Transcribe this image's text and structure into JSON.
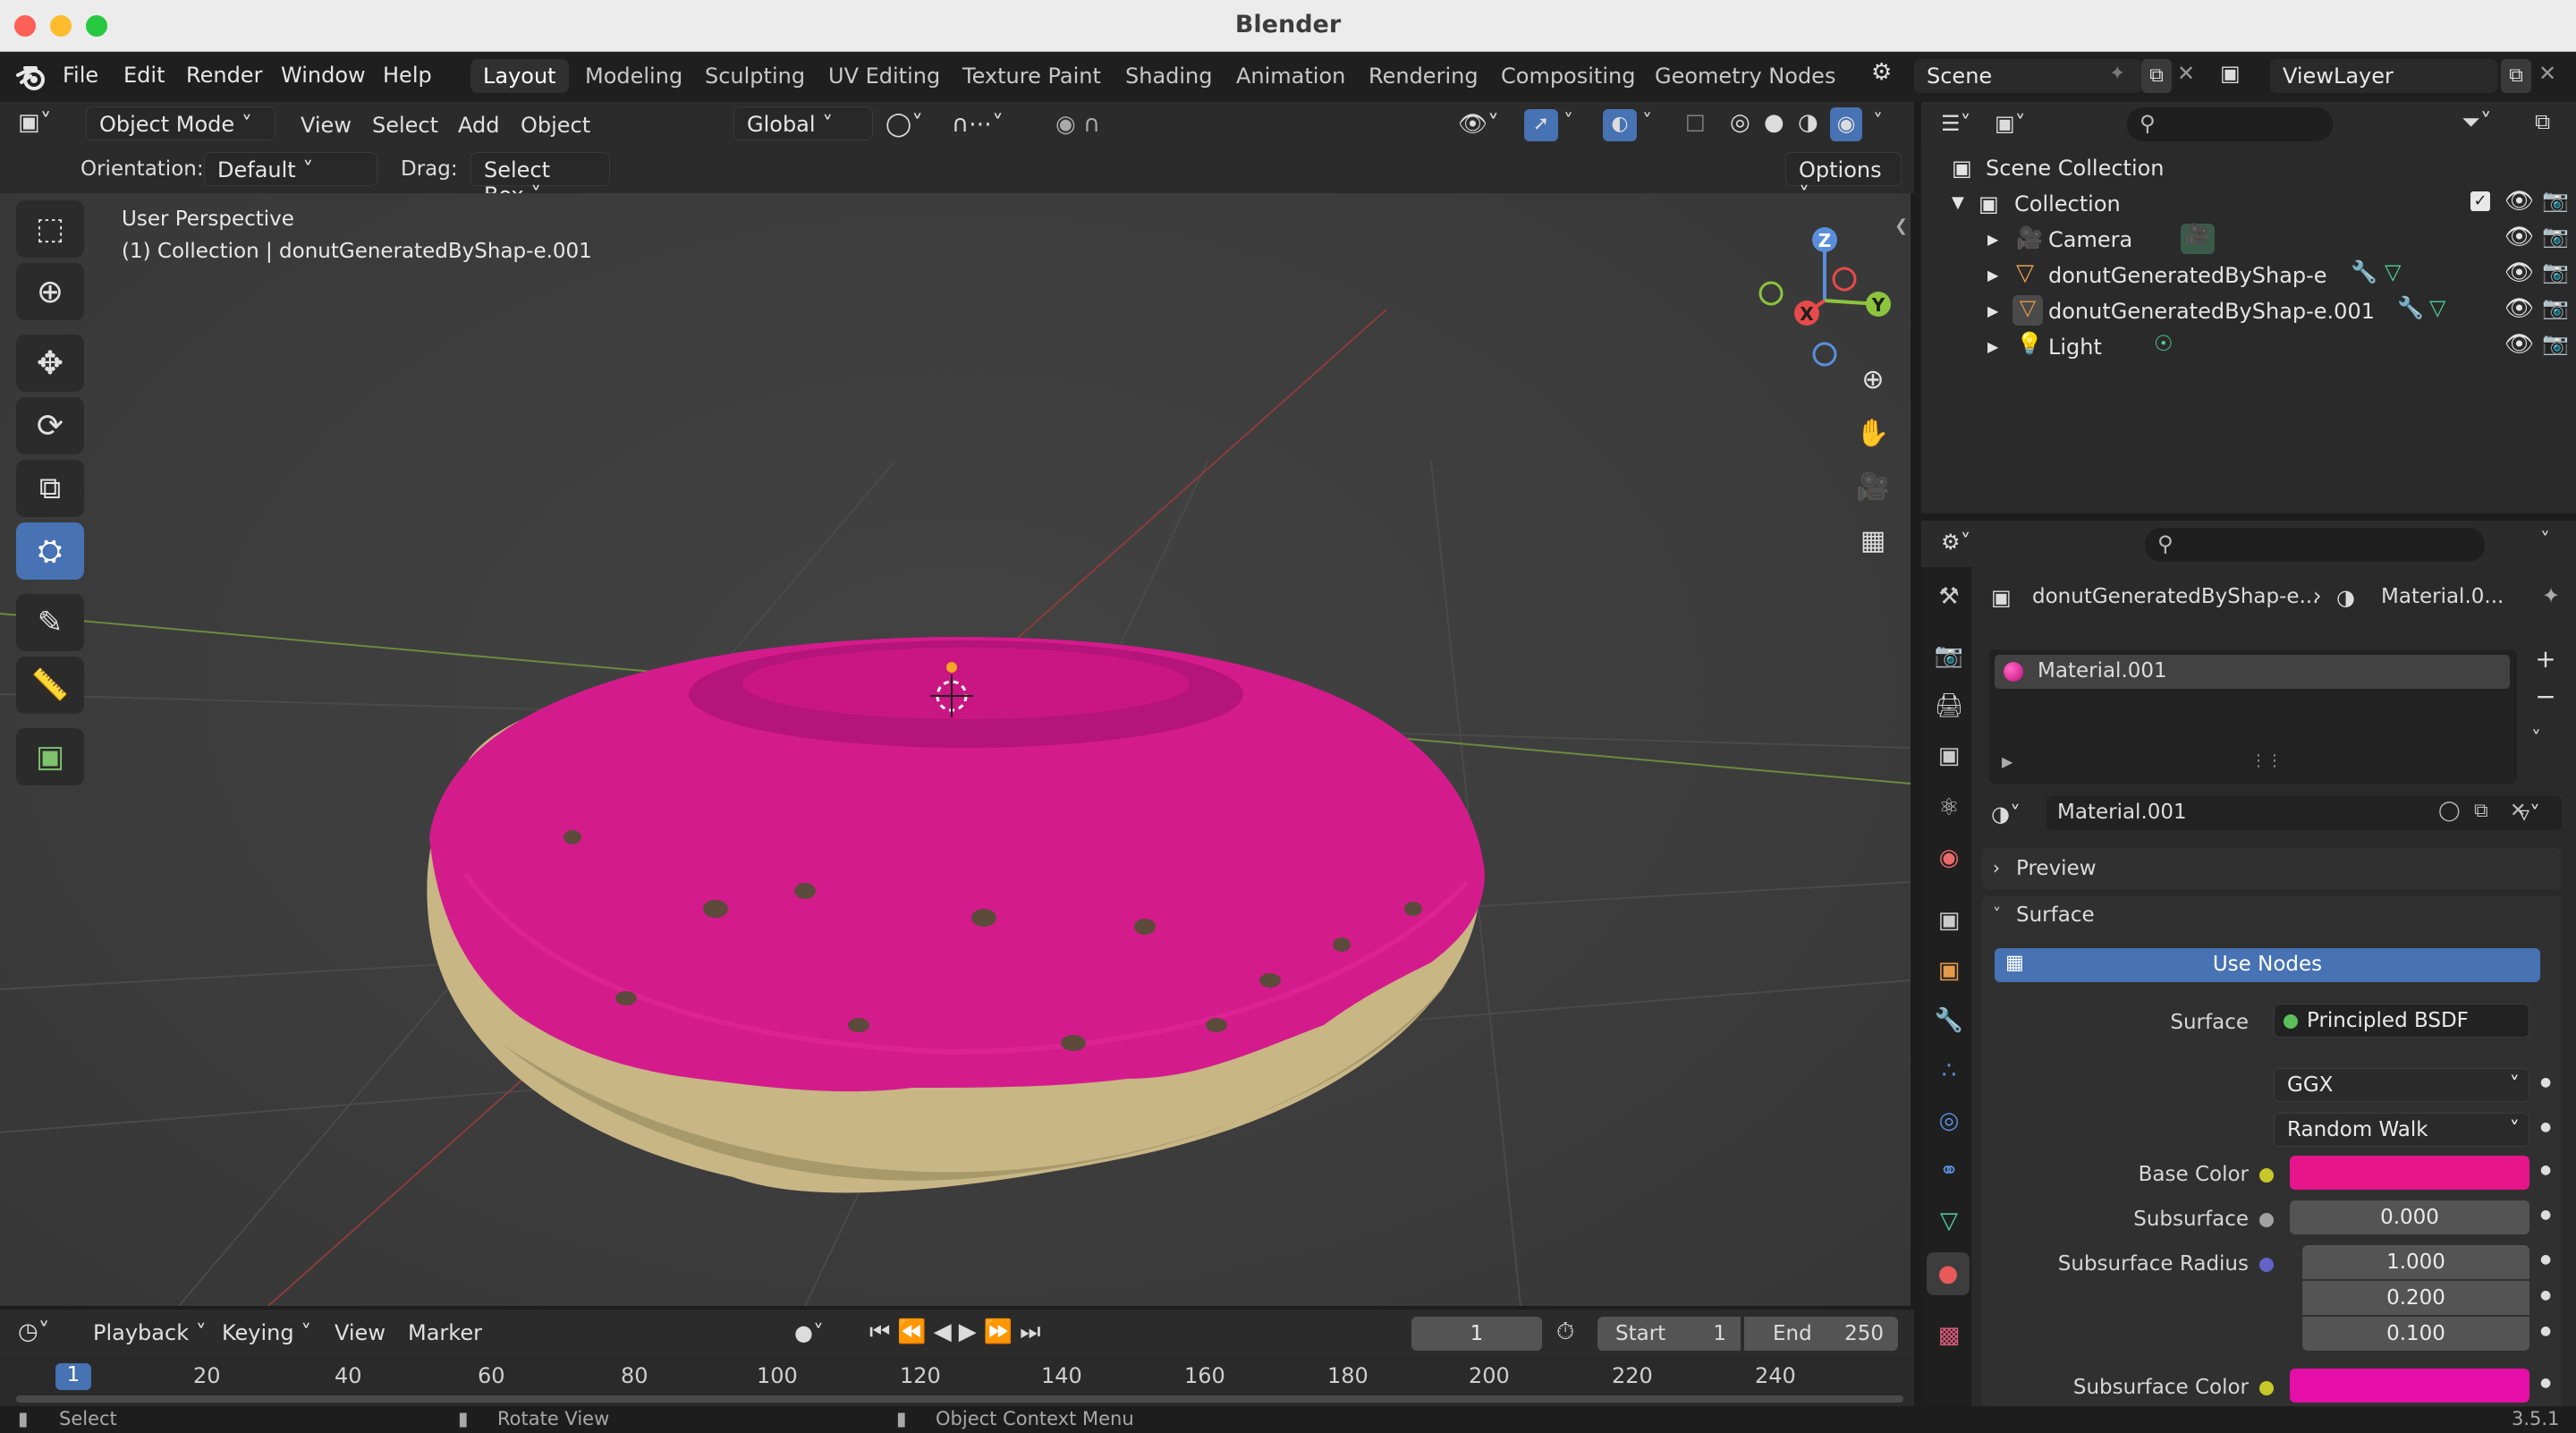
{
  "window": {
    "title": "Blender",
    "traffic_colors": [
      "#fe5f57",
      "#febc2e",
      "#28c840"
    ]
  },
  "menu": {
    "items": [
      "File",
      "Edit",
      "Render",
      "Window",
      "Help"
    ]
  },
  "workspaces": {
    "tabs": [
      "Layout",
      "Modeling",
      "Sculpting",
      "UV Editing",
      "Texture Paint",
      "Shading",
      "Animation",
      "Rendering",
      "Compositing",
      "Geometry Nodes"
    ],
    "active": "Layout"
  },
  "scene": {
    "name": "Scene",
    "view_layer": "ViewLayer"
  },
  "viewport_header": {
    "mode": "Object Mode",
    "menus": [
      "View",
      "Select",
      "Add",
      "Object"
    ],
    "transform": "Global"
  },
  "tool_settings": {
    "orientation_label": "Orientation:",
    "orientation_value": "Default",
    "drag_label": "Drag:",
    "drag_value": "Select Box",
    "options": "Options"
  },
  "viewport": {
    "perspective": "User Perspective",
    "collection_info": "(1) Collection | donutGeneratedByShap-e.001",
    "gizmo_axes": {
      "x": "X",
      "y": "Y",
      "z": "Z"
    }
  },
  "outliner": {
    "root": "Scene Collection",
    "collection": "Collection",
    "items": [
      {
        "name": "Camera",
        "icon": "camera-icon"
      },
      {
        "name": "donutGeneratedByShap-e",
        "icon": "mesh-icon"
      },
      {
        "name": "donutGeneratedByShap-e.001",
        "icon": "mesh-icon"
      },
      {
        "name": "Light",
        "icon": "light-icon"
      }
    ]
  },
  "properties": {
    "breadcrumb_object": "donutGeneratedByShap-e...",
    "breadcrumb_material": "Material.0...",
    "slot": "Material.001",
    "material_name": "Material.001",
    "panels": {
      "preview": "Preview",
      "surface": "Surface"
    },
    "use_nodes": "Use Nodes",
    "surface_label": "Surface",
    "surface_shader": "Principled BSDF",
    "distribution": "GGX",
    "subsurface_method": "Random Walk",
    "base_color_label": "Base Color",
    "base_color": "#e6168a",
    "subsurface_label": "Subsurface",
    "subsurface_value": "0.000",
    "subsurface_radius_label": "Subsurface Radius",
    "subsurface_radius": [
      "1.000",
      "0.200",
      "0.100"
    ],
    "subsurface_color_label": "Subsurface Color",
    "subsurface_color": "#e60ea8"
  },
  "timeline": {
    "menus": [
      "Playback",
      "Keying",
      "View",
      "Marker"
    ],
    "current_frame": "1",
    "start_label": "Start",
    "start": "1",
    "end_label": "End",
    "end": "250",
    "ticks": [
      "1",
      "20",
      "40",
      "60",
      "80",
      "100",
      "120",
      "140",
      "160",
      "180",
      "200",
      "220",
      "240"
    ]
  },
  "status_bar": {
    "items": [
      "Select",
      "Rotate View",
      "Object Context Menu"
    ],
    "version": "3.5.1"
  }
}
